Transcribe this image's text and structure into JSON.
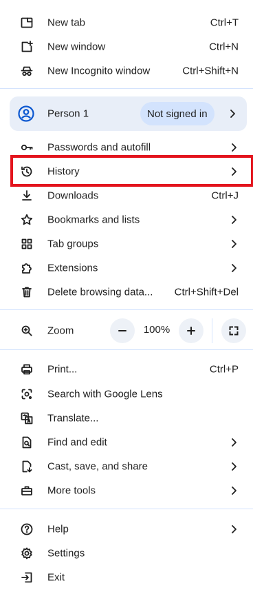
{
  "colors": {
    "divider": "#d3e3fd",
    "profile_bg": "#e8eef8",
    "badge_bg": "#d3e3fd",
    "highlight": "#e3141d",
    "text": "#1f1f1f"
  },
  "top": {
    "new_tab": {
      "label": "New tab",
      "shortcut": "Ctrl+T",
      "icon": "new-tab-icon"
    },
    "new_window": {
      "label": "New window",
      "shortcut": "Ctrl+N",
      "icon": "new-window-icon"
    },
    "incognito": {
      "label": "New Incognito window",
      "shortcut": "Ctrl+Shift+N",
      "icon": "incognito-icon"
    }
  },
  "profile": {
    "name": "Person 1",
    "status": "Not signed in",
    "icon": "account-circle-icon"
  },
  "items": {
    "passwords": {
      "label": "Passwords and autofill",
      "icon": "key-icon"
    },
    "history": {
      "label": "History",
      "icon": "history-icon"
    },
    "downloads": {
      "label": "Downloads",
      "shortcut": "Ctrl+J",
      "icon": "download-icon"
    },
    "bookmarks": {
      "label": "Bookmarks and lists",
      "icon": "star-icon"
    },
    "tab_groups": {
      "label": "Tab groups",
      "icon": "tab-groups-icon"
    },
    "extensions": {
      "label": "Extensions",
      "icon": "puzzle-icon"
    },
    "delete_data": {
      "label": "Delete browsing data...",
      "shortcut": "Ctrl+Shift+Del",
      "icon": "trash-icon"
    }
  },
  "zoom": {
    "label": "Zoom",
    "value": "100%",
    "icon": "zoom-icon"
  },
  "tools": {
    "print": {
      "label": "Print...",
      "shortcut": "Ctrl+P",
      "icon": "printer-icon"
    },
    "lens": {
      "label": "Search with Google Lens",
      "icon": "lens-icon"
    },
    "translate": {
      "label": "Translate...",
      "icon": "translate-icon"
    },
    "find_edit": {
      "label": "Find and edit",
      "icon": "find-page-icon"
    },
    "cast": {
      "label": "Cast, save, and share",
      "icon": "cast-save-icon"
    },
    "more_tools": {
      "label": "More tools",
      "icon": "toolbox-icon"
    }
  },
  "bottom": {
    "help": {
      "label": "Help",
      "icon": "help-icon"
    },
    "settings": {
      "label": "Settings",
      "icon": "gear-icon"
    },
    "exit": {
      "label": "Exit",
      "icon": "exit-icon"
    }
  }
}
